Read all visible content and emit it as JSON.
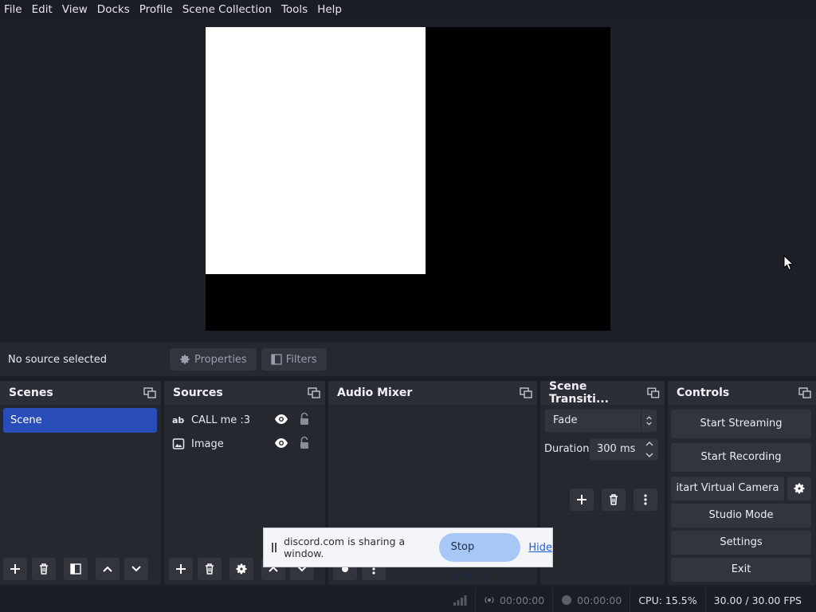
{
  "menu": [
    "File",
    "Edit",
    "View",
    "Docks",
    "Profile",
    "Scene Collection",
    "Tools",
    "Help"
  ],
  "context_bar": {
    "no_source": "No source selected",
    "properties": "Properties",
    "filters": "Filters"
  },
  "docks": {
    "scenes": {
      "title": "Scenes",
      "items": [
        "Scene"
      ]
    },
    "sources": {
      "title": "Sources",
      "items": [
        {
          "label": "CALL me :3",
          "icon": "text-icon"
        },
        {
          "label": "Image",
          "icon": "image-icon"
        }
      ]
    },
    "mixer": {
      "title": "Audio Mixer"
    },
    "transitions": {
      "title": "Scene Transiti...",
      "selected": "Fade",
      "duration_label": "Duration",
      "duration_value": "300 ms"
    },
    "controls": {
      "title": "Controls",
      "start_streaming": "Start Streaming",
      "start_recording": "Start Recording",
      "start_virtual_camera": "itart Virtual Camera",
      "studio_mode": "Studio Mode",
      "settings": "Settings",
      "exit": "Exit"
    }
  },
  "status": {
    "stream_time": "00:00:00",
    "rec_time": "00:00:00",
    "cpu": "CPU: 15.5%",
    "fps": "30.00 / 30.00 FPS"
  },
  "share_bar": {
    "message": "discord.com is sharing a window.",
    "stop": "Stop sharing",
    "hide": "Hide"
  },
  "colors": {
    "accent": "#284cb8",
    "panel": "#262830",
    "button": "#32343e",
    "stop_button": "#a7c7f7"
  }
}
